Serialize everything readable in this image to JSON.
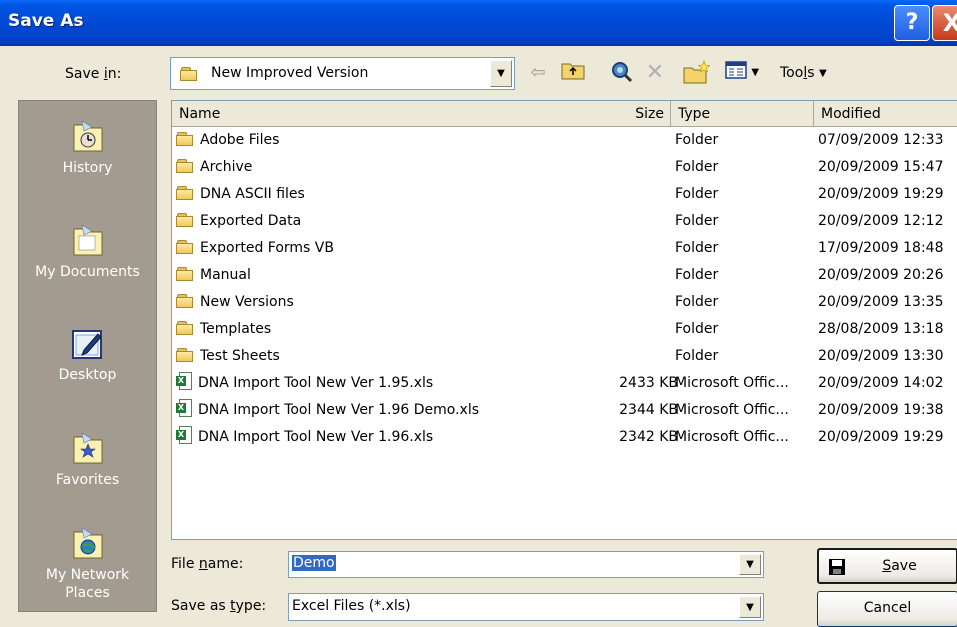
{
  "window": {
    "title": "Save As"
  },
  "title_buttons": {
    "help": "?",
    "close": "X"
  },
  "save_in": {
    "label_pre": "Save ",
    "label_key": "i",
    "label_post": "n:",
    "value": "New Improved Version"
  },
  "toolbar": {
    "tools_label_pre": "Too",
    "tools_label_key": "l",
    "tools_label_post": "s"
  },
  "places": [
    {
      "label": "History",
      "icon": "history-icon"
    },
    {
      "label": "My Documents",
      "icon": "my-documents-icon"
    },
    {
      "label": "Desktop",
      "icon": "desktop-icon"
    },
    {
      "label": "Favorites",
      "icon": "favorites-icon"
    },
    {
      "label": "My Network Places",
      "icon": "network-places-icon"
    }
  ],
  "columns": {
    "name": "Name",
    "size": "Size",
    "type": "Type",
    "modified": "Modified"
  },
  "files": [
    {
      "name": "Adobe Files",
      "size": "",
      "type": "Folder",
      "modified": "07/09/2009 12:33",
      "kind": "folder"
    },
    {
      "name": "Archive",
      "size": "",
      "type": "Folder",
      "modified": "20/09/2009 15:47",
      "kind": "folder"
    },
    {
      "name": "DNA ASCII files",
      "size": "",
      "type": "Folder",
      "modified": "20/09/2009 19:29",
      "kind": "folder"
    },
    {
      "name": "Exported Data",
      "size": "",
      "type": "Folder",
      "modified": "20/09/2009 12:12",
      "kind": "folder"
    },
    {
      "name": "Exported Forms VB",
      "size": "",
      "type": "Folder",
      "modified": "17/09/2009 18:48",
      "kind": "folder"
    },
    {
      "name": "Manual",
      "size": "",
      "type": "Folder",
      "modified": "20/09/2009 20:26",
      "kind": "folder"
    },
    {
      "name": "New Versions",
      "size": "",
      "type": "Folder",
      "modified": "20/09/2009 13:35",
      "kind": "folder"
    },
    {
      "name": "Templates",
      "size": "",
      "type": "Folder",
      "modified": "28/08/2009 13:18",
      "kind": "folder"
    },
    {
      "name": "Test Sheets",
      "size": "",
      "type": "Folder",
      "modified": "20/09/2009 13:30",
      "kind": "folder"
    },
    {
      "name": "DNA Import Tool New Ver 1.95.xls",
      "size": "2433 KB",
      "type": "Microsoft Offic...",
      "modified": "20/09/2009 14:02",
      "kind": "xls"
    },
    {
      "name": "DNA Import Tool New Ver 1.96 Demo.xls",
      "size": "2344 KB",
      "type": "Microsoft Offic...",
      "modified": "20/09/2009 19:38",
      "kind": "xls"
    },
    {
      "name": "DNA Import Tool New Ver 1.96.xls",
      "size": "2342 KB",
      "type": "Microsoft Offic...",
      "modified": "20/09/2009 19:29",
      "kind": "xls"
    }
  ],
  "file_name": {
    "label_pre": "File ",
    "label_key": "n",
    "label_post": "ame:",
    "value": "Demo"
  },
  "save_as_type": {
    "label_pre": "Save as ",
    "label_key": "t",
    "label_post": "ype:",
    "value": "Excel Files (*.xls)"
  },
  "buttons": {
    "save_key": "S",
    "save_rest": "ave",
    "cancel": "Cancel"
  }
}
